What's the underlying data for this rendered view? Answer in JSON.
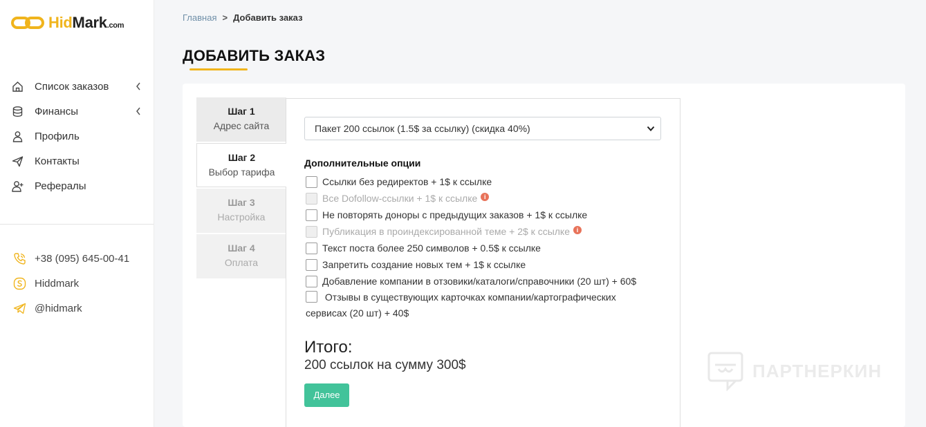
{
  "brand": {
    "logo_hid": "Hid",
    "logo_mark": "Mark",
    "logo_com": ".com",
    "accent": "#f0b41c"
  },
  "sidebar": {
    "items": [
      {
        "label": "Список заказов",
        "icon": "home-icon",
        "has_chevron": true
      },
      {
        "label": "Финансы",
        "icon": "coins-icon",
        "has_chevron": true
      },
      {
        "label": "Профиль",
        "icon": "user-icon",
        "has_chevron": false
      },
      {
        "label": "Контакты",
        "icon": "send-icon",
        "has_chevron": false
      },
      {
        "label": "Рефералы",
        "icon": "user-plus-icon",
        "has_chevron": false
      }
    ],
    "contacts": [
      {
        "label": "+38 (095) 645-00-41",
        "icon": "phone-icon"
      },
      {
        "label": "Hiddmark",
        "icon": "skype-icon"
      },
      {
        "label": "@hidmark",
        "icon": "telegram-icon"
      }
    ]
  },
  "breadcrumb": {
    "home": "Главная",
    "separator": ">",
    "current": "Добавить заказ"
  },
  "page": {
    "title": "ДОБАВИТЬ ЗАКАЗ"
  },
  "steps": [
    {
      "num": "Шаг 1",
      "name": "Адрес сайта",
      "state": "done"
    },
    {
      "num": "Шаг 2",
      "name": "Выбор тарифа",
      "state": "active"
    },
    {
      "num": "Шаг 3",
      "name": "Настройка",
      "state": "disabled"
    },
    {
      "num": "Шаг 4",
      "name": "Оплата",
      "state": "disabled"
    }
  ],
  "form": {
    "package_select": "Пакет 200 ссылок (1.5$ за ссылку) (скидка 40%)",
    "options_title": "Дополнительные опции",
    "options": [
      {
        "label": "Ссылки без редиректов + 1$ к ссылке",
        "disabled": false,
        "info": false
      },
      {
        "label": "Все Dofollow-ссылки + 1$ к ссылке",
        "disabled": true,
        "info": true
      },
      {
        "label": "Не повторять доноры с предыдущих заказов + 1$ к ссылке",
        "disabled": false,
        "info": false
      },
      {
        "label": "Публикация в проиндексированной теме + 2$ к ссылке",
        "disabled": true,
        "info": true
      },
      {
        "label": "Текст поста более 250 символов + 0.5$ к ссылке",
        "disabled": false,
        "info": false
      },
      {
        "label": "Запретить создание новых тем + 1$ к ссылке",
        "disabled": false,
        "info": false
      },
      {
        "label": "Добавление компании в отзовики/каталоги/справочники (20 шт) + 60$",
        "disabled": false,
        "info": false
      },
      {
        "label": "Отзывы в существующих карточках компании/картографических сервисах (20 шт) + 40$",
        "disabled": false,
        "info": false
      }
    ],
    "total_title": "Итого:",
    "total_summary": "200 ссылок на сумму 300$",
    "next_button": "Далее",
    "button_color": "#42c39a"
  },
  "watermark": {
    "text": "ПАРТНЕРКИН"
  }
}
